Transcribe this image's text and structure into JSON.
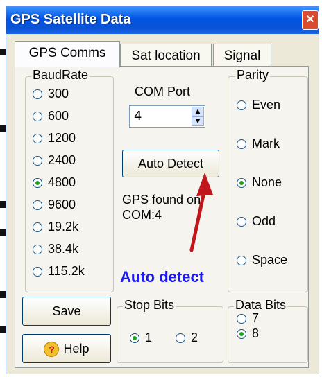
{
  "window": {
    "title": "GPS Satellite Data",
    "close_icon": "close-icon"
  },
  "tabs": [
    {
      "label": "GPS Comms",
      "active": true
    },
    {
      "label": "Sat location",
      "active": false
    },
    {
      "label": "Signal",
      "active": false
    }
  ],
  "baudrate": {
    "label": "BaudRate",
    "options": [
      "300",
      "600",
      "1200",
      "2400",
      "4800",
      "9600",
      "19.2k",
      "38.4k",
      "115.2k"
    ],
    "selected": "4800"
  },
  "comport": {
    "label": "COM Port",
    "value": "4"
  },
  "autodetect": {
    "button_label": "Auto Detect",
    "status_line1": "GPS found on",
    "status_line2": "COM:4",
    "annotation": "Auto detect",
    "annotation_color": "#1b1bf0",
    "arrow_color": "#c0171c"
  },
  "parity": {
    "label": "Parity",
    "options": [
      "Even",
      "Mark",
      "None",
      "Odd",
      "Space"
    ],
    "selected": "None"
  },
  "buttons": {
    "save_label": "Save",
    "help_label": "Help"
  },
  "stopbits": {
    "label": "Stop Bits",
    "options": [
      "1",
      "2"
    ],
    "selected": "1"
  },
  "databits": {
    "label": "Data Bits",
    "options": [
      "7",
      "8"
    ],
    "selected": "8"
  }
}
